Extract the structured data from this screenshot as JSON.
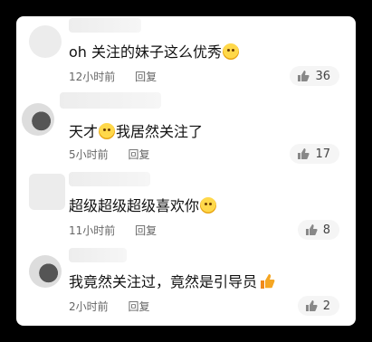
{
  "comments": [
    {
      "text": "oh 关注的妹子这么优秀",
      "time": "12小时前",
      "reply": "回复",
      "likes": "36"
    },
    {
      "text_a": "天才",
      "text_b": "我居然关注了",
      "time": "5小时前",
      "reply": "回复",
      "likes": "17"
    },
    {
      "text": "超级超级超级喜欢你",
      "time": "11小时前",
      "reply": "回复",
      "likes": "8"
    },
    {
      "text": "我竟然关注过，竟然是引导员",
      "time": "2小时前",
      "reply": "回复",
      "likes": "2"
    }
  ],
  "icons": {
    "like": "thumbs-up-icon",
    "emoji": "smiley-emoji-icon"
  },
  "colors": {
    "background": "#000000",
    "card": "#ffffff",
    "like_pill": "#f5f5f5"
  }
}
